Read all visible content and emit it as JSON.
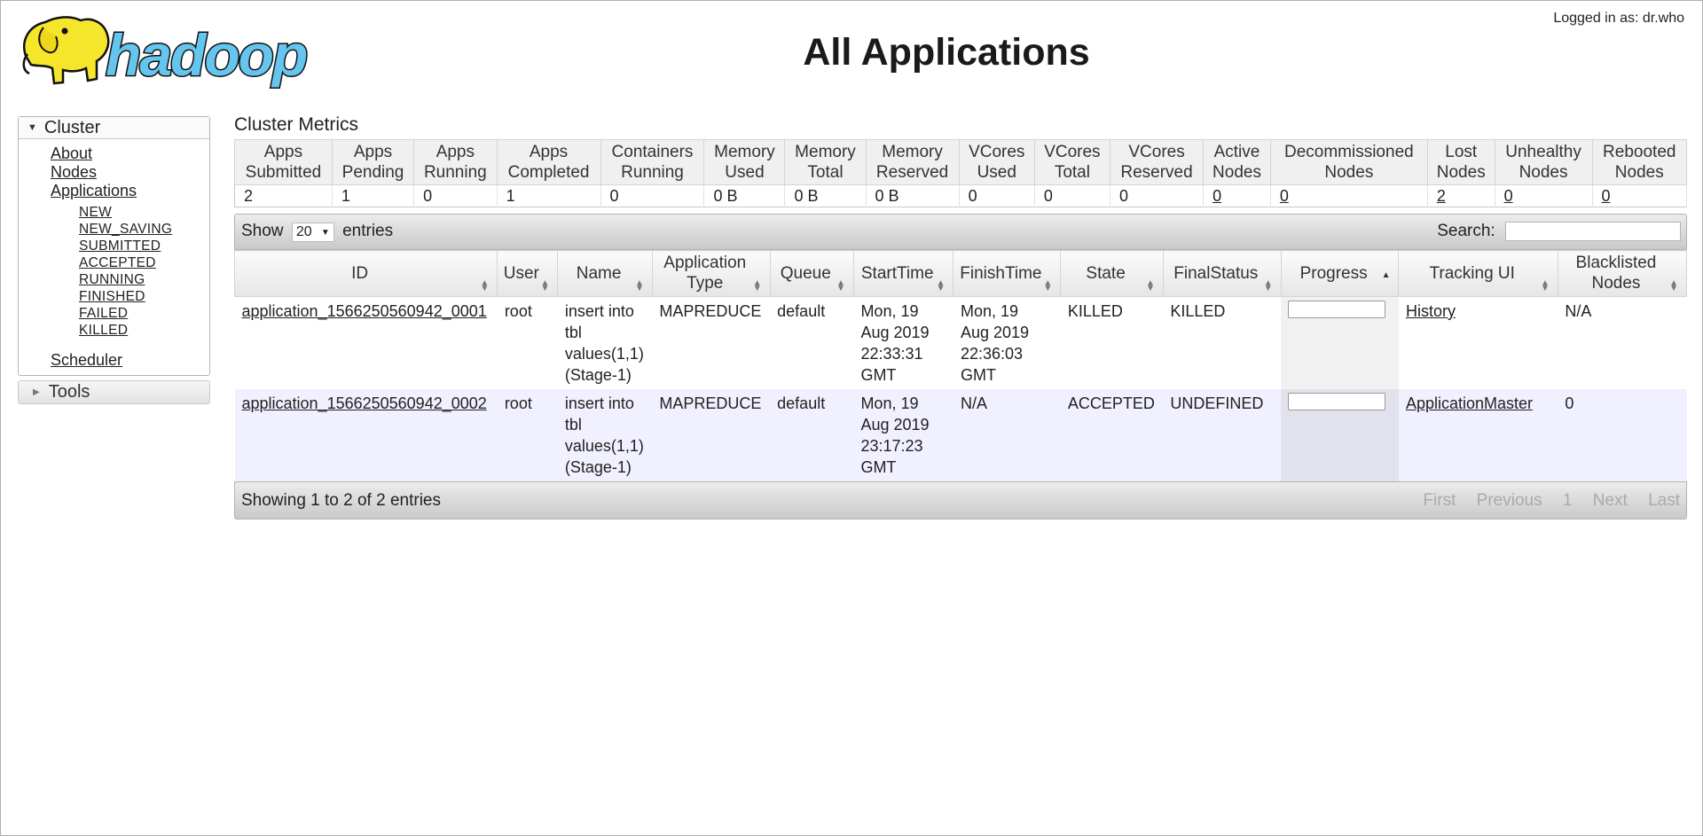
{
  "header": {
    "logo_text": "hadoop",
    "title": "All Applications",
    "logged_in": "Logged in as: dr.who"
  },
  "nav": {
    "cluster_label": "Cluster",
    "items": [
      "About",
      "Nodes",
      "Applications"
    ],
    "app_states": [
      "NEW",
      "NEW_SAVING",
      "SUBMITTED",
      "ACCEPTED",
      "RUNNING",
      "FINISHED",
      "FAILED",
      "KILLED"
    ],
    "scheduler": "Scheduler",
    "tools_label": "Tools"
  },
  "metrics": {
    "title": "Cluster Metrics",
    "headers": [
      [
        "Apps",
        "Submitted"
      ],
      [
        "Apps",
        "Pending"
      ],
      [
        "Apps",
        "Running"
      ],
      [
        "Apps",
        "Completed"
      ],
      [
        "Containers",
        "Running"
      ],
      [
        "Memory",
        "Used"
      ],
      [
        "Memory",
        "Total"
      ],
      [
        "Memory",
        "Reserved"
      ],
      [
        "VCores",
        "Used"
      ],
      [
        "VCores",
        "Total"
      ],
      [
        "VCores",
        "Reserved"
      ],
      [
        "Active",
        "Nodes"
      ],
      [
        "Decommissioned",
        "Nodes"
      ],
      [
        "Lost",
        "Nodes"
      ],
      [
        "Unhealthy",
        "Nodes"
      ],
      [
        "Rebooted",
        "Nodes"
      ]
    ],
    "values": [
      "2",
      "1",
      "0",
      "1",
      "0",
      "0 B",
      "0 B",
      "0 B",
      "0",
      "0",
      "0",
      "0",
      "0",
      "2",
      "0",
      "0"
    ]
  },
  "table_controls": {
    "show": "Show",
    "entries_value": "20",
    "entries": "entries",
    "search_label": "Search:",
    "info": "Showing 1 to 2 of 2 entries",
    "pager": [
      "First",
      "Previous",
      "1",
      "Next",
      "Last"
    ]
  },
  "apps": {
    "headers": [
      [
        "ID"
      ],
      [
        "User"
      ],
      [
        "Name"
      ],
      [
        "Application",
        "Type"
      ],
      [
        "Queue"
      ],
      [
        "StartTime"
      ],
      [
        "FinishTime"
      ],
      [
        "State"
      ],
      [
        "FinalStatus"
      ],
      [
        "Progress"
      ],
      [
        "Tracking UI"
      ],
      [
        "Blacklisted",
        "Nodes"
      ]
    ],
    "rows": [
      {
        "id": "application_1566250560942_0001",
        "user": "root",
        "name": [
          "insert into",
          "tbl",
          "values(1,1)",
          "(Stage-1)"
        ],
        "type": "MAPREDUCE",
        "queue": "default",
        "start": [
          "Mon, 19",
          "Aug 2019",
          "22:33:31",
          "GMT"
        ],
        "finish": [
          "Mon, 19",
          "Aug 2019",
          "22:36:03",
          "GMT"
        ],
        "state": "KILLED",
        "final_status": "KILLED",
        "progress": 0,
        "tracking": "History",
        "blacklisted": "N/A"
      },
      {
        "id": "application_1566250560942_0002",
        "user": "root",
        "name": [
          "insert into",
          "tbl",
          "values(1,1)",
          "(Stage-1)"
        ],
        "type": "MAPREDUCE",
        "queue": "default",
        "start": [
          "Mon, 19",
          "Aug 2019",
          "23:17:23",
          "GMT"
        ],
        "finish": [
          "N/A"
        ],
        "state": "ACCEPTED",
        "final_status": "UNDEFINED",
        "progress": 0,
        "tracking": "ApplicationMaster",
        "blacklisted": "0"
      }
    ]
  },
  "colors": {
    "logo_yellow": "#f5e62c",
    "logo_blue": "#65c5ee",
    "even_row": "#f0f0ff"
  }
}
